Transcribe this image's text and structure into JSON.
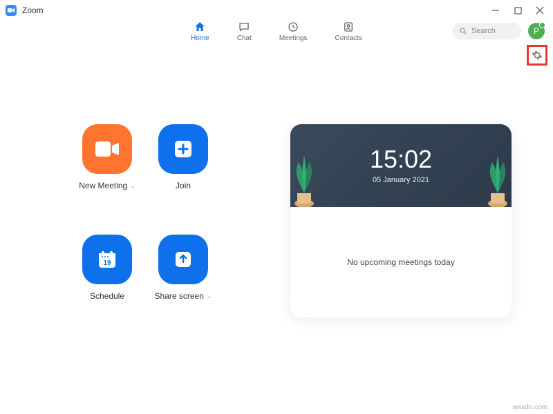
{
  "window": {
    "title": "Zoom"
  },
  "nav": {
    "home": "Home",
    "chat": "Chat",
    "meetings": "Meetings",
    "contacts": "Contacts"
  },
  "search": {
    "placeholder": "Search"
  },
  "avatar": {
    "initial": "P"
  },
  "actions": {
    "new_meeting": "New Meeting",
    "join": "Join",
    "schedule": "Schedule",
    "schedule_day": "19",
    "share_screen": "Share screen"
  },
  "clock": {
    "time": "15:02",
    "date": "05 January 2021"
  },
  "upcoming": {
    "empty_text": "No upcoming meetings today"
  },
  "footer": {
    "text": "wsxdn.com"
  }
}
